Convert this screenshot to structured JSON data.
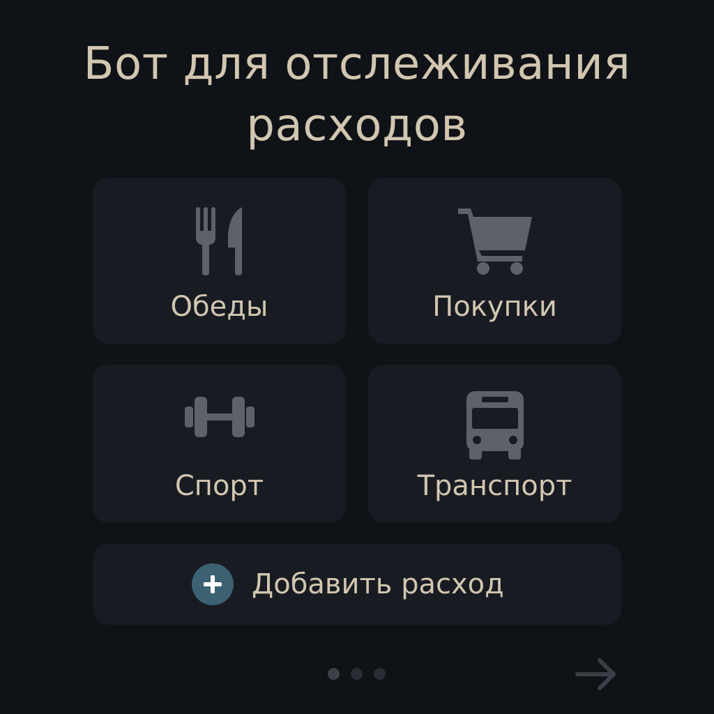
{
  "title": {
    "line1": "Бот для отслеживания",
    "line2": "расходов"
  },
  "categories": [
    {
      "label": "Обеды",
      "icon": "fork-knife-icon"
    },
    {
      "label": "Покупки",
      "icon": "shopping-cart-icon"
    },
    {
      "label": "Спорт",
      "icon": "dumbbell-icon"
    },
    {
      "label": "Транспорт",
      "icon": "bus-icon"
    }
  ],
  "add_button": {
    "label": "Добавить расход",
    "icon": "plus-icon"
  },
  "pager": {
    "pages": 3,
    "active_index": 0
  },
  "colors": {
    "background": "#0f1216",
    "card": "#181c22",
    "text": "#d2c6b1",
    "icon": "#5d6168",
    "accent": "#3b6172"
  }
}
